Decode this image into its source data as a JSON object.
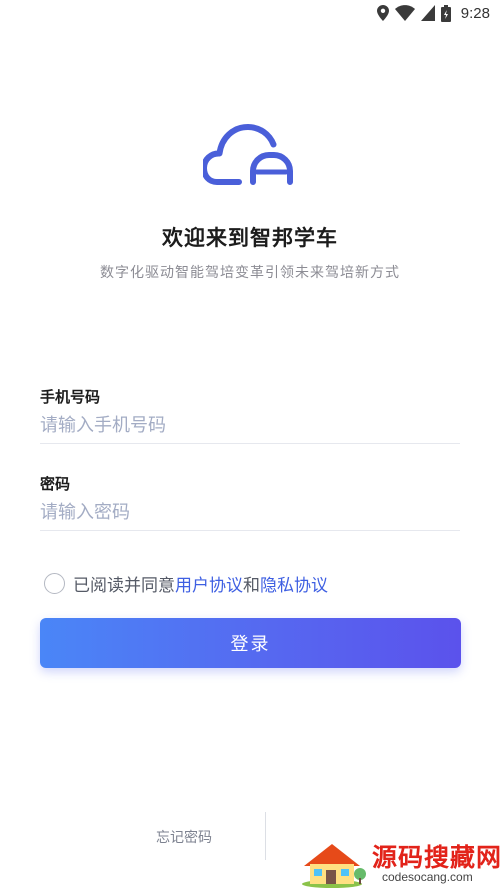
{
  "status_bar": {
    "time": "9:28",
    "icons": [
      "location-icon",
      "wifi-icon",
      "signal-icon",
      "battery-icon"
    ]
  },
  "header": {
    "logo": "cloud-car-logo",
    "title": "欢迎来到智邦学车",
    "subtitle": "数字化驱动智能驾培变革引领未来驾培新方式"
  },
  "form": {
    "phone": {
      "label": "手机号码",
      "placeholder": "请输入手机号码",
      "value": ""
    },
    "password": {
      "label": "密码",
      "placeholder": "请输入密码",
      "value": ""
    },
    "agreement": {
      "checked": false,
      "prefix": "已阅读并同意",
      "user_agreement": "用户协议",
      "joiner": "和",
      "privacy_agreement": "隐私协议"
    },
    "login_label": "登录"
  },
  "footer": {
    "forgot_password": "忘记密码"
  },
  "watermark": {
    "text": "源码搜藏网",
    "url": "codesocang.com"
  },
  "colors": {
    "accent": "#3e5fe2",
    "button_start": "#4a86f7",
    "button_end": "#5b52ec",
    "placeholder": "#a3acc4",
    "logo": "#4a5fd9"
  }
}
